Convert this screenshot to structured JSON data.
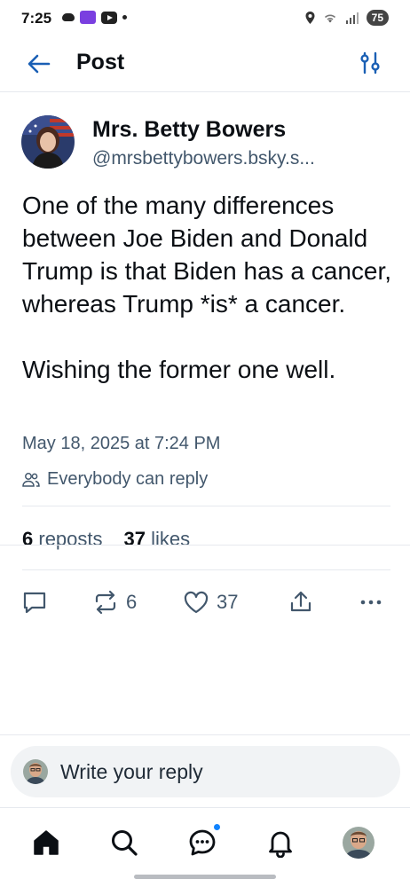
{
  "status_bar": {
    "time": "7:25",
    "battery": "75"
  },
  "header": {
    "title": "Post",
    "back_icon": "arrow-left-icon",
    "filter_icon": "sliders-icon"
  },
  "post": {
    "display_name": "Mrs. Betty Bowers",
    "handle": "@mrsbettybowers.bsky.s...",
    "body": "One of the many differences between Joe Biden and Donald Trump is that Biden has a cancer, whereas Trump *is* a cancer.\n\nWishing the former one well.",
    "timestamp": "May 18, 2025 at 7:24 PM",
    "reply_setting": "Everybody can reply",
    "stats": {
      "reposts_count": "6",
      "reposts_label": "reposts",
      "likes_count": "37",
      "likes_label": "likes"
    },
    "actions": {
      "reply_icon": "comment-icon",
      "repost_icon": "repost-icon",
      "repost_count": "6",
      "like_icon": "heart-icon",
      "like_count": "37",
      "share_icon": "share-icon",
      "more_icon": "more-icon"
    }
  },
  "composer": {
    "placeholder": "Write your reply"
  },
  "bottom_nav": {
    "items": [
      "home-icon",
      "search-icon",
      "chat-icon",
      "bell-icon",
      "profile-avatar"
    ],
    "has_chat_badge": true
  },
  "colors": {
    "accent": "#1083fe",
    "text": "#0b0f14",
    "muted": "#42576c",
    "border": "#e6e9ee"
  }
}
